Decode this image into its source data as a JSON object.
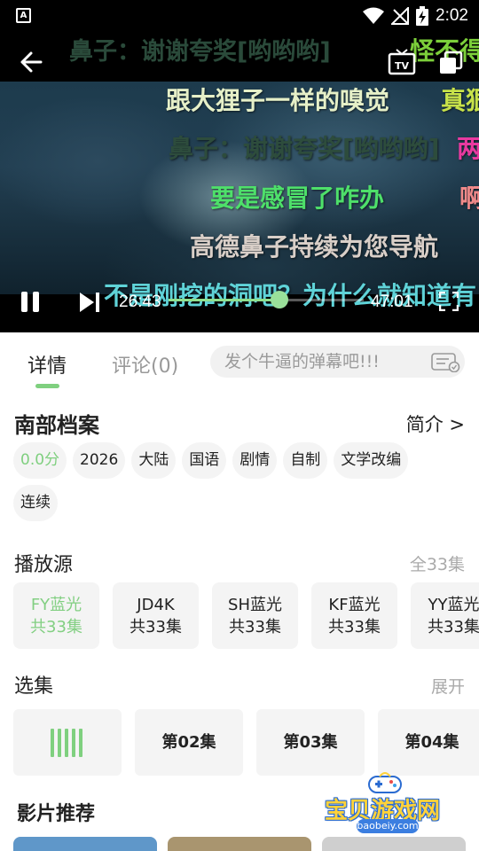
{
  "status_bar": {
    "time": "2:02"
  },
  "video": {
    "danmaku": [
      {
        "text": "鼻子：谢谢夸奖[哟哟哟]",
        "color": "#2a4a3a"
      },
      {
        "text": "怪不得",
        "color": "#7ccf3a"
      },
      {
        "text": "跟大狸子一样的嗅觉",
        "color": "#e6f0c8"
      },
      {
        "text": "真狠",
        "color": "#c8e24a"
      },
      {
        "text": "鼻子：谢谢夸奖[哟哟哟]",
        "color": "#2d4c3c"
      },
      {
        "text": "两",
        "color": "#e83aa0"
      },
      {
        "text": "要是感冒了咋办",
        "color": "#4ee06a"
      },
      {
        "text": "啊",
        "color": "#f08a8a"
      },
      {
        "text": "高德鼻子持续为您导航",
        "color": "#d9cfc8"
      },
      {
        "text": "不是刚挖的洞吧？为什么就知道有",
        "color": "#5fd3d8"
      }
    ],
    "current_time": "26:43",
    "total_time": "47:01",
    "progress": 0.5683
  },
  "tabs": {
    "details": "详情",
    "comments": "评论(0)",
    "danmaku_placeholder": "发个牛逼的弹幕吧!!!"
  },
  "info": {
    "title": "南部档案",
    "intro_link": "简介 >",
    "tags": [
      "0.0分",
      "2026",
      "大陆",
      "国语",
      "剧情",
      "自制",
      "文学改编",
      "连续"
    ]
  },
  "sources": {
    "title": "播放源",
    "count": "全33集",
    "items": [
      {
        "name": "FY蓝光",
        "episodes": "共33集"
      },
      {
        "name": "JD4K",
        "episodes": "共33集"
      },
      {
        "name": "SH蓝光",
        "episodes": "共33集"
      },
      {
        "name": "KF蓝光",
        "episodes": "共33集"
      },
      {
        "name": "YY蓝光",
        "episodes": "共33集"
      }
    ]
  },
  "episodes": {
    "title": "选集",
    "expand": "展开",
    "items": [
      "第02集",
      "第03集",
      "第04集"
    ]
  },
  "recommend": {
    "title": "影片推荐"
  },
  "watermark": {
    "text": "宝贝游戏网",
    "url": "baobeiy.com"
  },
  "colors": {
    "accent": "#7fd07f",
    "chip_bg": "#f4f4f4"
  }
}
